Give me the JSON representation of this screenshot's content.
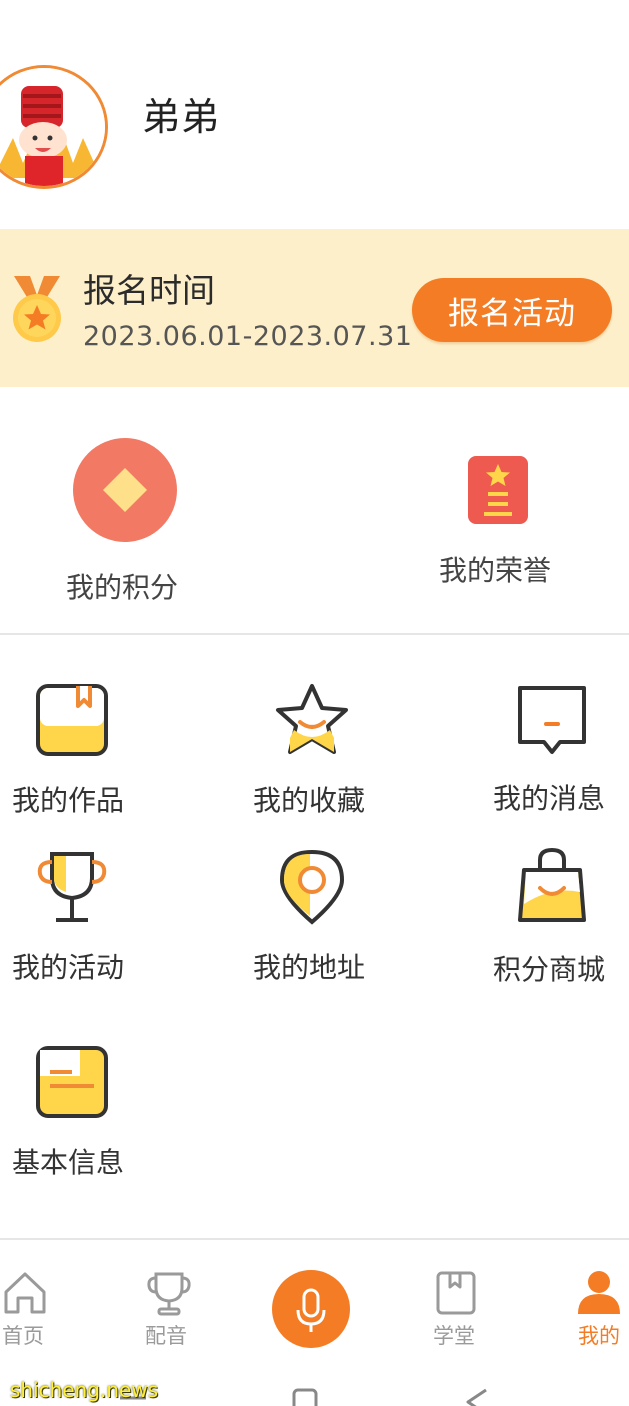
{
  "profile": {
    "nickname": "弟弟"
  },
  "banner": {
    "title": "报名时间",
    "date_range": "2023.06.01-2023.07.31",
    "button_label": "报名活动"
  },
  "stats": {
    "points_label": "我的积分",
    "honors_label": "我的荣誉"
  },
  "menu": {
    "items": [
      {
        "label": "我的作品",
        "icon": "book-icon"
      },
      {
        "label": "我的收藏",
        "icon": "star-icon"
      },
      {
        "label": "我的消息",
        "icon": "message-icon"
      },
      {
        "label": "我的活动",
        "icon": "trophy-icon"
      },
      {
        "label": "我的地址",
        "icon": "location-pin-icon"
      },
      {
        "label": "积分商城",
        "icon": "shopping-bag-icon"
      },
      {
        "label": "基本信息",
        "icon": "info-card-icon"
      }
    ]
  },
  "nav": {
    "items": [
      {
        "label": "首页",
        "icon": "home-icon"
      },
      {
        "label": "配音",
        "icon": "trophy-icon"
      },
      {
        "label": "",
        "icon": "microphone-icon"
      },
      {
        "label": "学堂",
        "icon": "book-icon"
      },
      {
        "label": "我的",
        "icon": "person-icon",
        "active": true
      }
    ]
  },
  "watermark": "shicheng.news",
  "colors": {
    "accent": "#f47c24",
    "banner_bg": "#fdefc9",
    "icon_yellow": "#ffd54a",
    "points_red": "#f27963",
    "honor_red": "#ee5a4f"
  }
}
